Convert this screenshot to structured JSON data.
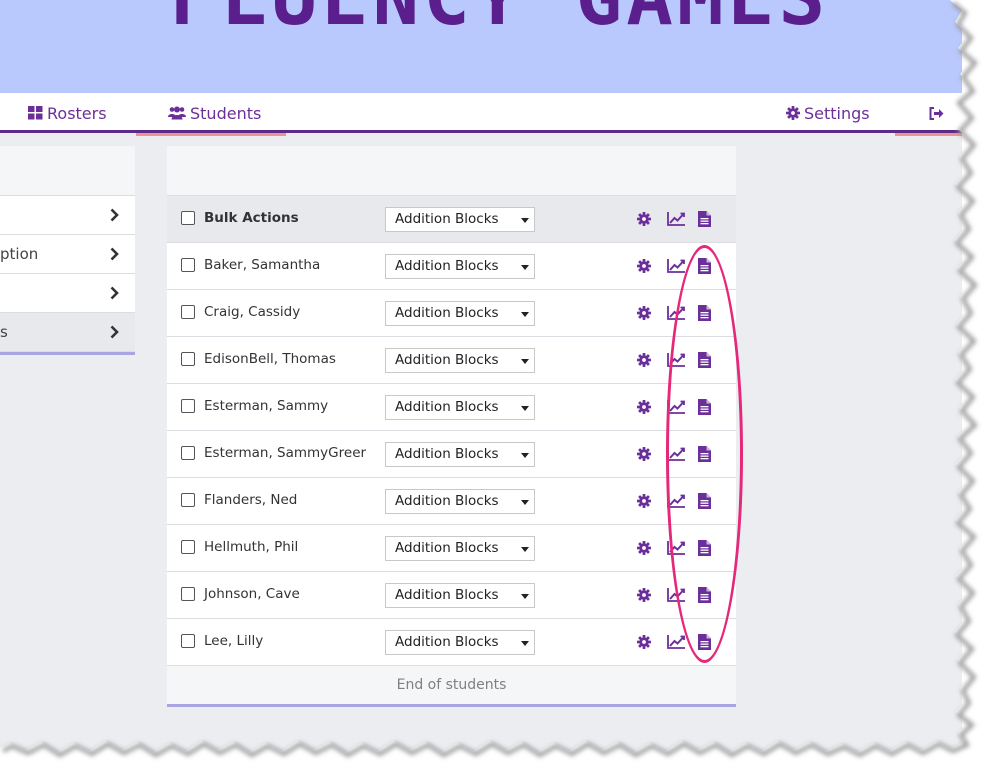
{
  "banner": {
    "title": "FLUENCY GAMES"
  },
  "nav": {
    "rosters": "Rosters",
    "students": "Students",
    "settings": "Settings",
    "logout": ""
  },
  "sidemenu": {
    "items": [
      {
        "label": ""
      },
      {
        "label": "ption"
      },
      {
        "label": ""
      },
      {
        "label": "s"
      }
    ]
  },
  "students": {
    "bulk": {
      "label": "Bulk Actions",
      "game": "Addition Blocks"
    },
    "rows": [
      {
        "name": "Baker, Samantha",
        "game": "Addition Blocks"
      },
      {
        "name": "Craig, Cassidy",
        "game": "Addition Blocks"
      },
      {
        "name": "EdisonBell, Thomas",
        "game": "Addition Blocks"
      },
      {
        "name": "Esterman, Sammy",
        "game": "Addition Blocks"
      },
      {
        "name": "Esterman, SammyGreer",
        "game": "Addition Blocks"
      },
      {
        "name": "Flanders, Ned",
        "game": "Addition Blocks"
      },
      {
        "name": "Hellmuth, Phil",
        "game": "Addition Blocks"
      },
      {
        "name": "Johnson, Cave",
        "game": "Addition Blocks"
      },
      {
        "name": "Lee, Lilly",
        "game": "Addition Blocks"
      }
    ],
    "footer": "End of students"
  },
  "colors": {
    "accent": "#6b2f99",
    "banner": "#b9c9fd",
    "annotation": "#e5287a",
    "active_tab": "#f19191"
  },
  "icons": [
    "th-large-icon",
    "users-icon",
    "gear-icon",
    "sign-out-icon",
    "chevron-right-icon",
    "line-chart-icon",
    "file-text-icon",
    "checkbox-icon"
  ]
}
